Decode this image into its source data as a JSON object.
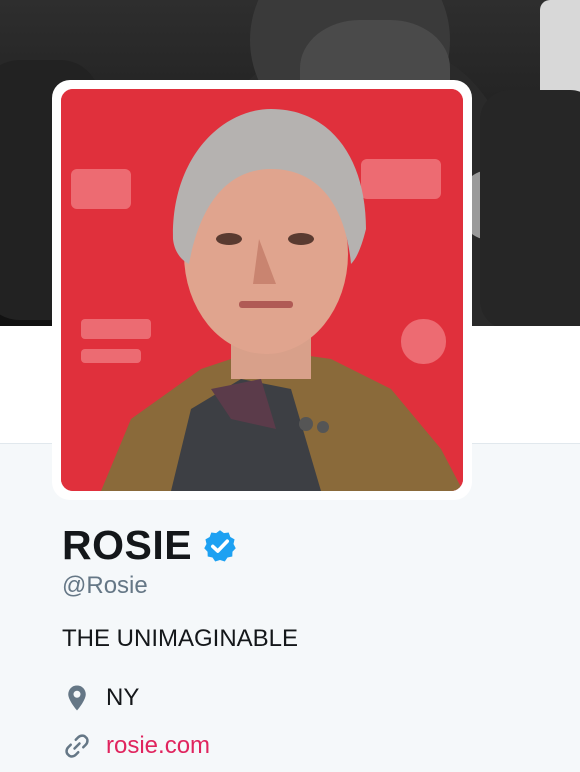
{
  "profile": {
    "name": "ROSIE",
    "handle": "@Rosie",
    "bio": "THE UNIMAGINABLE",
    "location": "NY",
    "url": "rosie.com",
    "verified": true
  },
  "icons": {
    "verified": "verified-badge-icon",
    "location": "map-pin-icon",
    "url": "link-icon"
  },
  "colors": {
    "verified_blue": "#1da1f2",
    "link_color": "#e0245e",
    "secondary_text": "#657786",
    "avatar_background": "#e0303c"
  }
}
